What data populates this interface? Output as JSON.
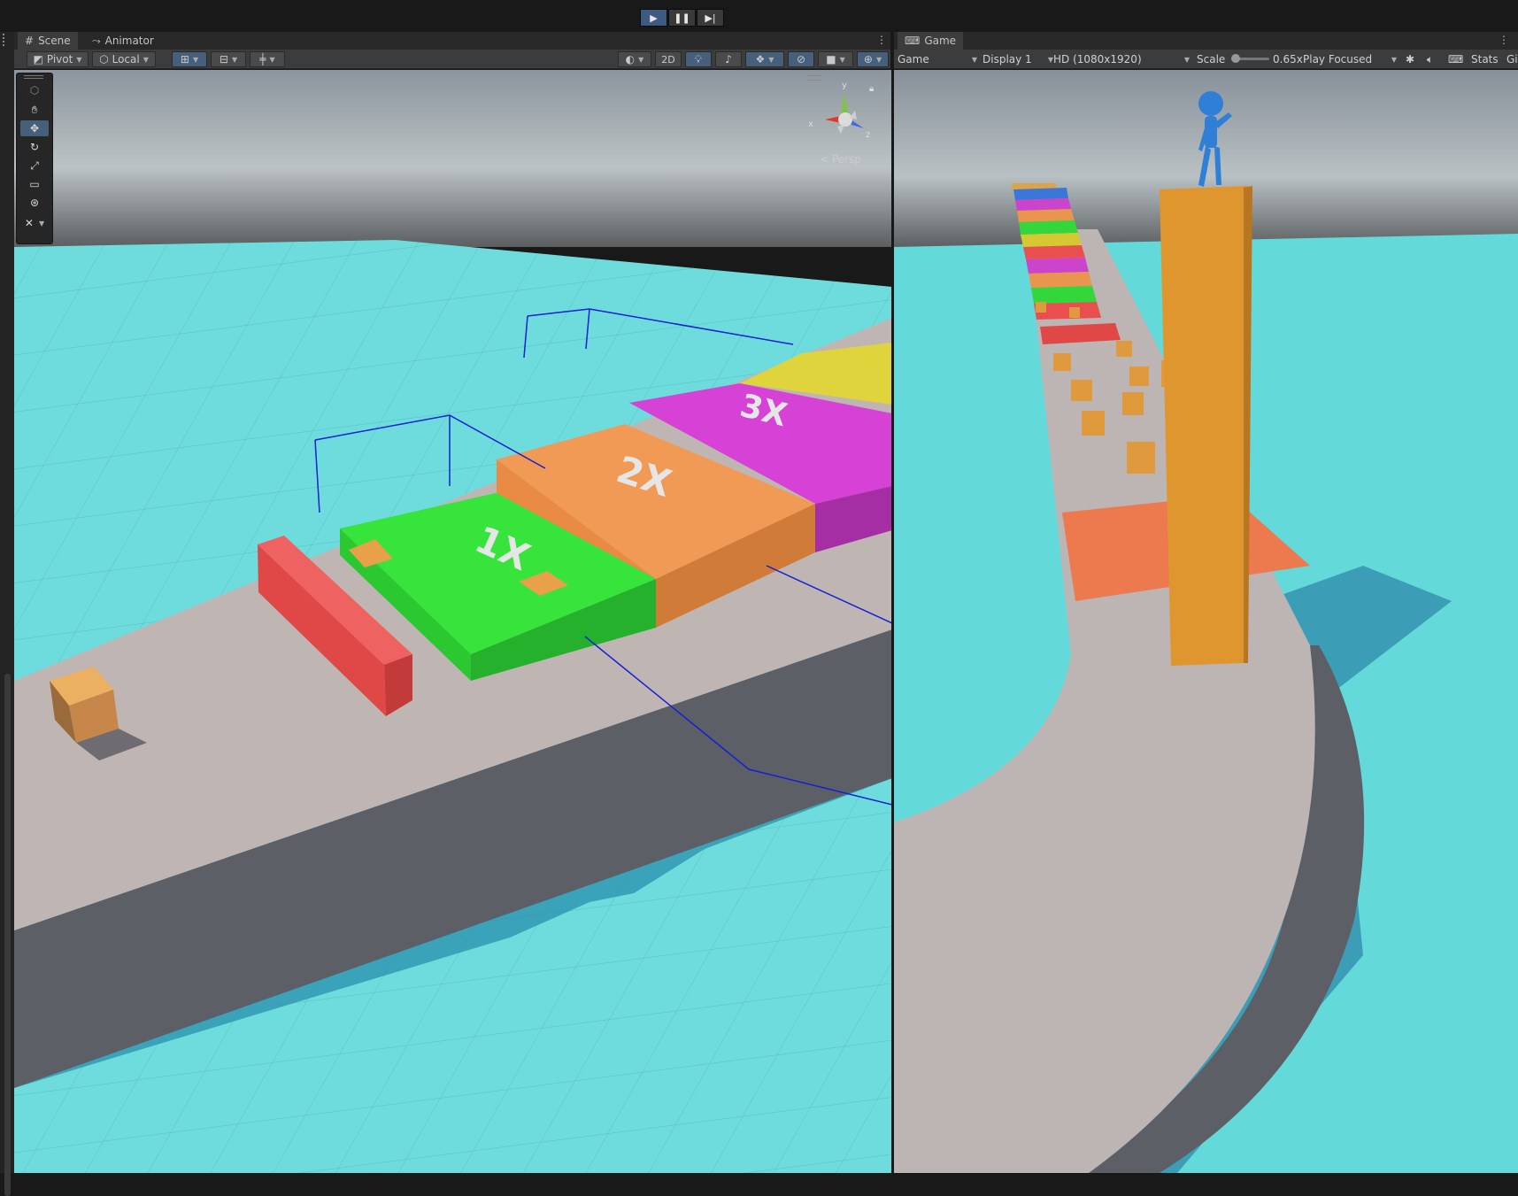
{
  "playbar": {
    "play_icon": "play-icon",
    "pause_icon": "pause-icon",
    "step_icon": "step-icon"
  },
  "scene_tabs": [
    {
      "label": "Scene",
      "icon": "scene-grid-icon"
    },
    {
      "label": "Animator",
      "icon": "animator-icon"
    }
  ],
  "scene_toolbar": {
    "pivot": "Pivot",
    "local": "Local",
    "mode_2d": "2D"
  },
  "gizmo": {
    "y": "y",
    "x": "x",
    "z": "z",
    "projection": "Persp"
  },
  "track_markers": [
    "1X",
    "2X",
    "3X"
  ],
  "game_tab": {
    "label": "Game",
    "icon": "gamepad-icon"
  },
  "game_toolbar": {
    "view": "Game",
    "display": "Display 1",
    "resolution": "HD (1080x1920)",
    "scale_label": "Scale",
    "scale_value": "0.65x",
    "play_mode": "Play Focused",
    "stats": "Stats",
    "gizmos": "Gi"
  },
  "colors": {
    "ground": "#6edcdc",
    "track": "#bfb6b4",
    "green": "#33d63b",
    "orange": "#e9954e",
    "magenta": "#d23fd2",
    "yellow": "#d5c933",
    "red": "#e94f4f",
    "character": "#2f7fd6",
    "tower": "#e0962f"
  }
}
